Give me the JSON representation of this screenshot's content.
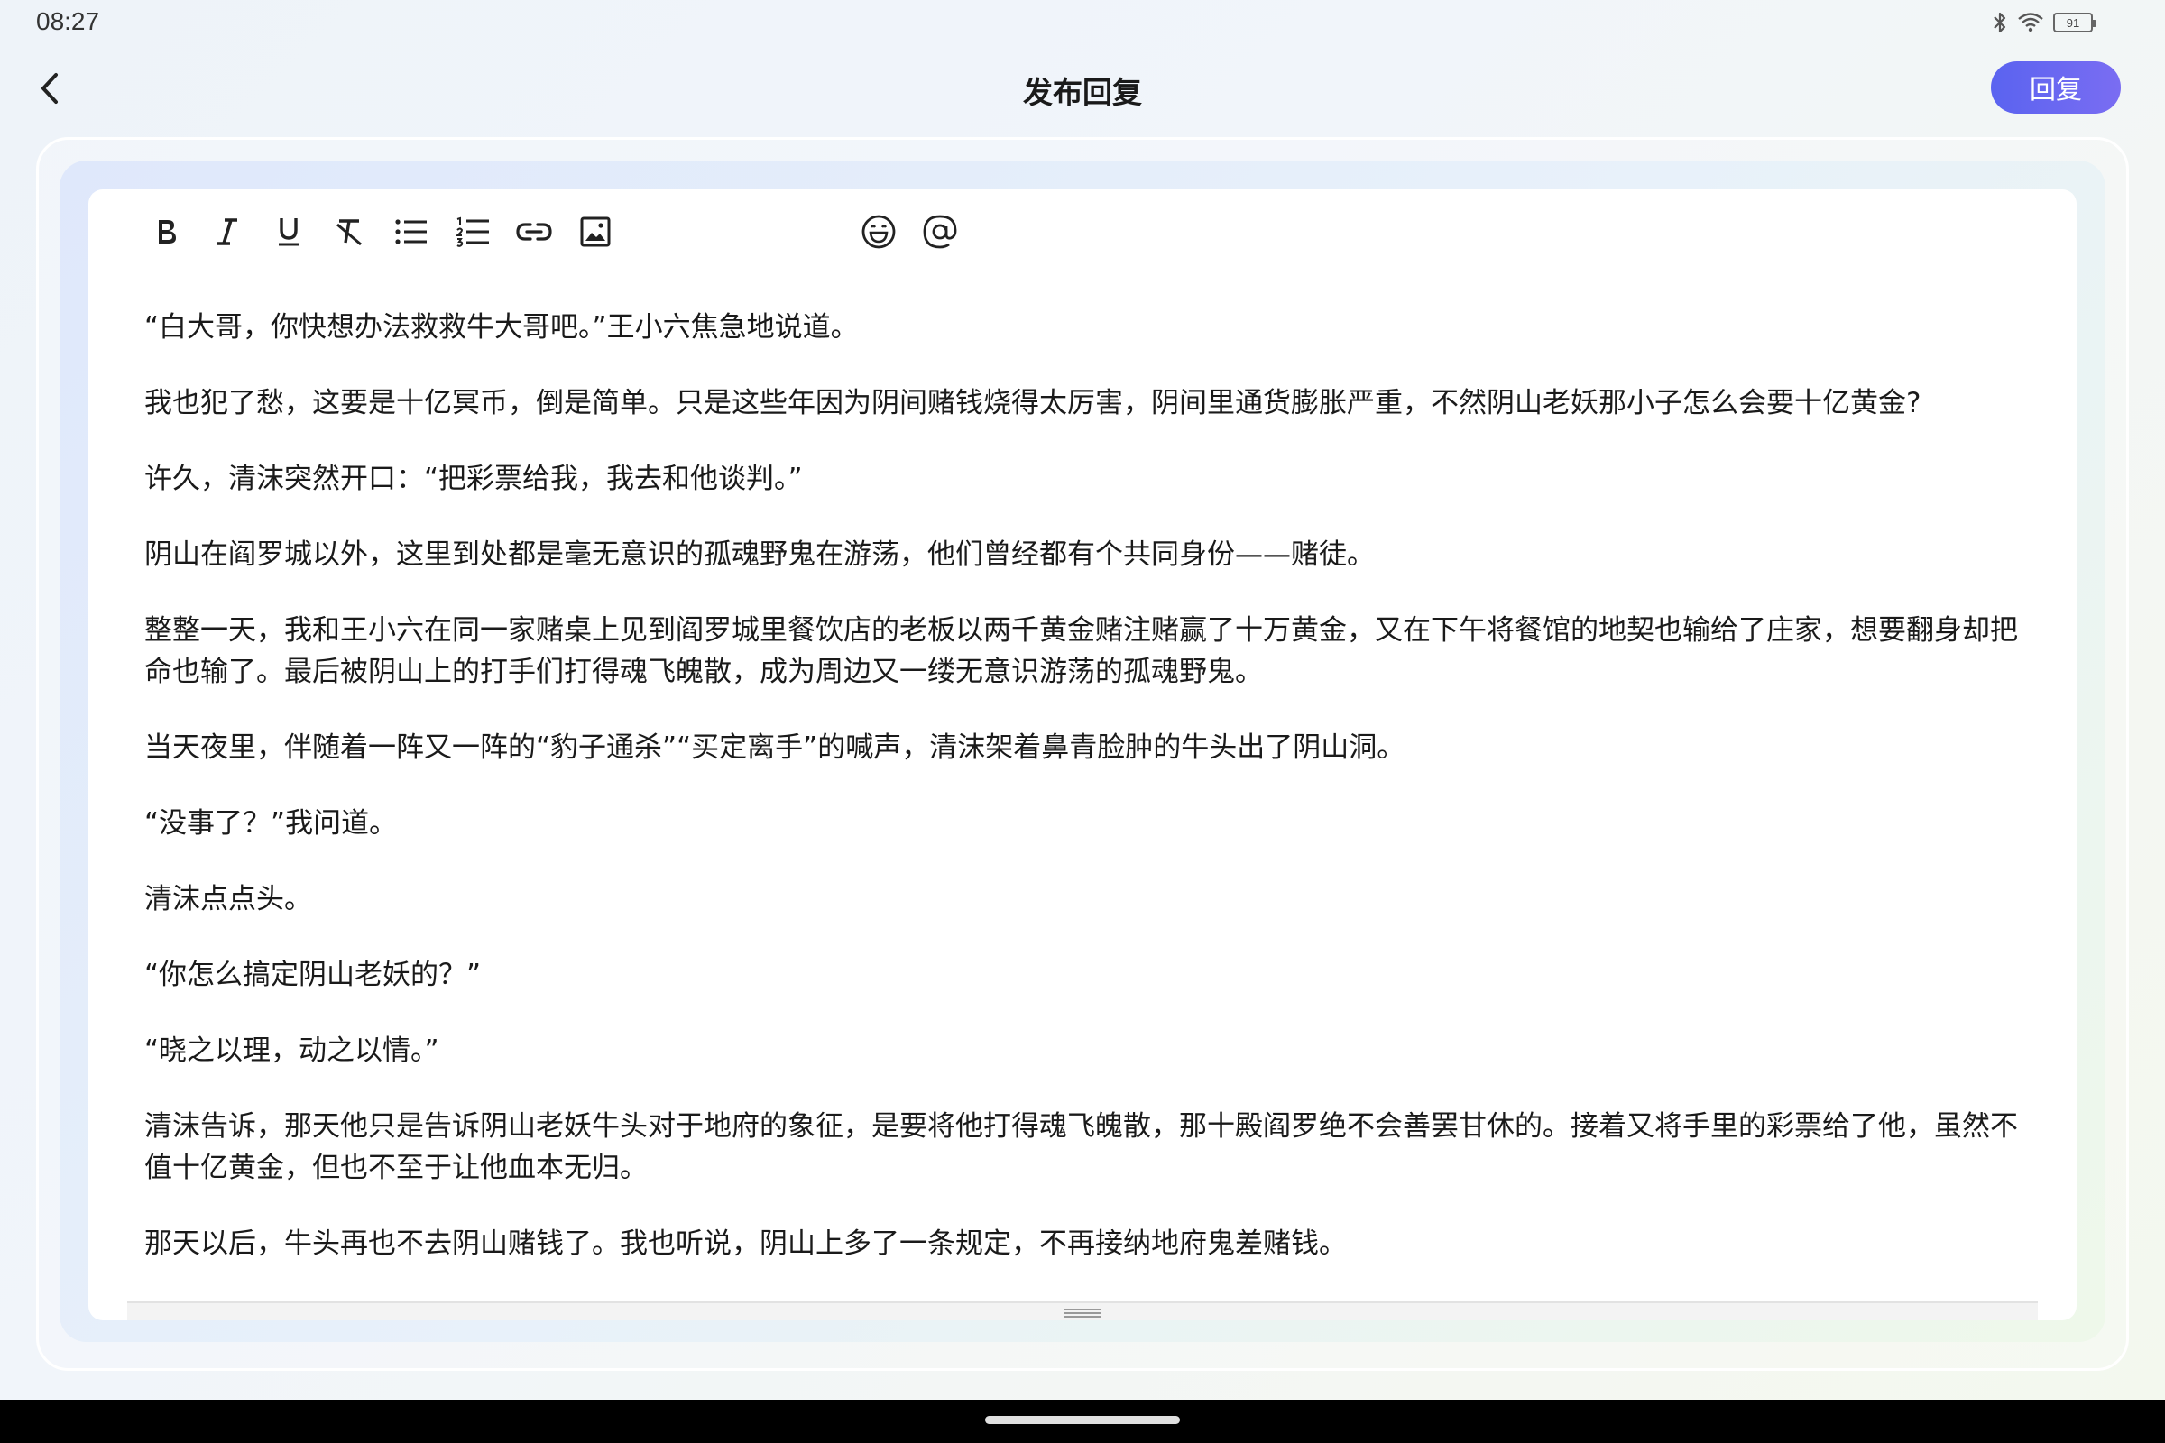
{
  "status_bar": {
    "time": "08:27",
    "battery_level": "91",
    "icons": [
      "bluetooth-icon",
      "wifi-icon",
      "battery-icon"
    ]
  },
  "header": {
    "title": "发布回复",
    "reply_label": "回复",
    "accent_gradient": [
      "#5a63f0",
      "#7a6df2"
    ]
  },
  "toolbar": {
    "tools": [
      "bold-icon",
      "italic-icon",
      "underline-icon",
      "clear-format-icon",
      "bullet-list-icon",
      "numbered-list-icon",
      "link-icon",
      "image-icon",
      "emoji-icon",
      "mention-icon"
    ]
  },
  "content": {
    "paragraphs": [
      "“白大哥，你快想办法救救牛大哥吧。”王小六焦急地说道。",
      "我也犯了愁，这要是十亿冥币，倒是简单。只是这些年因为阴间赌钱烧得太厉害，阴间里通货膨胀严重，不然阴山老妖那小子怎么会要十亿黄金?",
      "许久，清沫突然开口：“把彩票给我，我去和他谈判。”",
      "阴山在阎罗城以外，这里到处都是毫无意识的孤魂野鬼在游荡，他们曾经都有个共同身份——赌徒。",
      "整整一天，我和王小六在同一家赌桌上见到阎罗城里餐饮店的老板以两千黄金赌注赌赢了十万黄金，又在下午将餐馆的地契也输给了庄家，想要翻身却把命也输了。最后被阴山上的打手们打得魂飞魄散，成为周边又一缕无意识游荡的孤魂野鬼。",
      "当天夜里，伴随着一阵又一阵的“豹子通杀”“买定离手”的喊声，清沫架着鼻青脸肿的牛头出了阴山洞。",
      "“没事了？”我问道。",
      "清沫点点头。",
      "“你怎么搞定阴山老妖的？”",
      "“晓之以理，动之以情。”",
      "清沫告诉，那天他只是告诉阴山老妖牛头对于地府的象征，是要将他打得魂飞魄散，那十殿阎罗绝不会善罢甘休的。接着又将手里的彩票给了他，虽然不值十亿黄金，但也不至于让他血本无归。",
      "那天以后，牛头再也不去阴山赌钱了。我也听说，阴山上多了一条规定，不再接纳地府鬼差赌钱。"
    ]
  }
}
